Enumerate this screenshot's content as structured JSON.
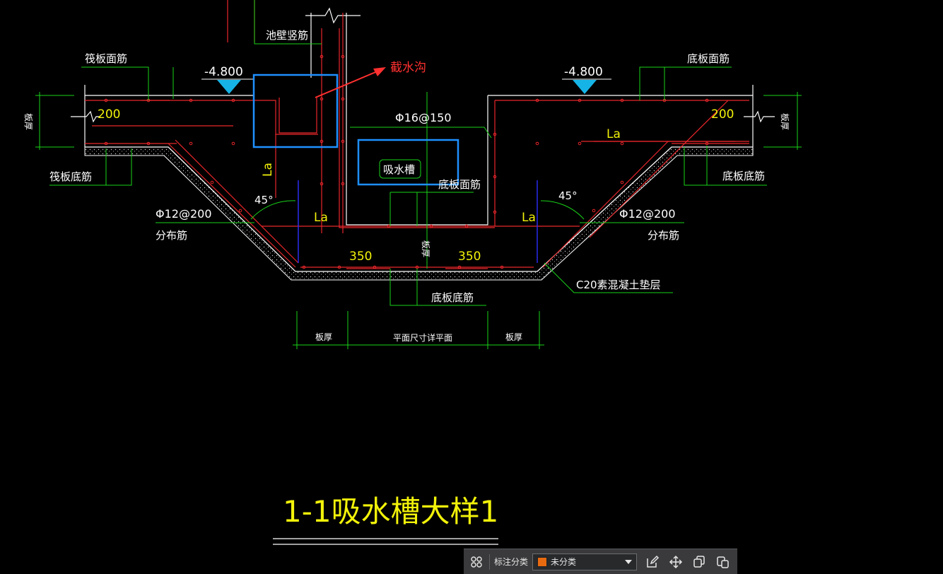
{
  "colors": {
    "background": "#000000",
    "rebar": "#e8262b",
    "leader": "#19d219",
    "concrete": "#ffffff",
    "text_white": "#ffffff",
    "text_yellow": "#f2f20a",
    "highlight_box": "#1e90ff",
    "annotation_red": "#ff3030",
    "level_marker": "#16b4e6",
    "axis_blue": "#2d2dff",
    "category_swatch": "#e86a10"
  },
  "labels": {
    "pool_wall_bars": "池壁竖筋",
    "raft_top_bars": "筏板面筋",
    "raft_bottom_bars": "筏板底筋",
    "slab_top_bars_right": "底板面筋",
    "slab_bottom_bars_right": "底板底筋",
    "slab_top_bars_center": "底板面筋",
    "slab_bottom_bars_center": "底板底筋",
    "level_left": "-4.800",
    "level_right": "-4.800",
    "intercept_ditch": "截水沟",
    "rebar_spec_center": "Φ16@150",
    "sump": "吸水槽",
    "dim_200_left": "200",
    "dim_200_right": "200",
    "la_vertical": "La",
    "la_left": "La",
    "la_right": "La",
    "la_right_top": "La",
    "angle_left": "45°",
    "angle_right": "45°",
    "dist_spec_left": "Φ12@200",
    "dist_spec_right": "Φ12@200",
    "dist_bars_left": "分布筋",
    "dist_bars_right": "分布筋",
    "dim_350_left": "350",
    "dim_350_right": "350",
    "slab_thickness_center": "板厚",
    "slab_thickness_left_edge": "板厚",
    "slab_thickness_right_edge": "板厚",
    "cushion": "C20素混凝土垫层",
    "dim_slab_left": "板厚",
    "dim_plan": "平面尺寸详平面",
    "dim_slab_right": "板厚",
    "title": "1-1吸水槽大样1"
  },
  "toolbar": {
    "grid_icon": "grid-icon",
    "category_label": "标注分类",
    "category_value": "未分类",
    "tools": [
      "edit-icon",
      "move-icon",
      "copy-icon",
      "paste-icon"
    ]
  }
}
